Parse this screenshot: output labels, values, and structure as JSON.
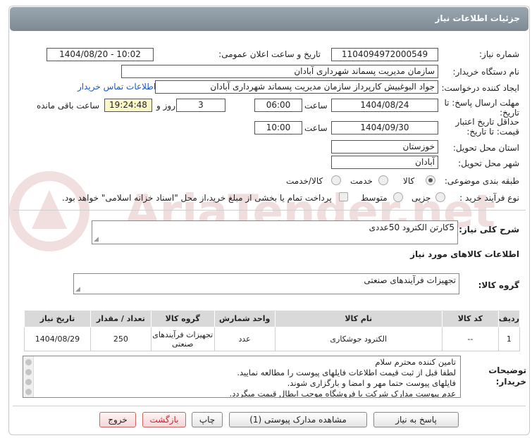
{
  "header": {
    "title": "جزئیات اطلاعات نیاز"
  },
  "fields": {
    "need_number_label": "شماره نیاز:",
    "need_number": "1104094972000549",
    "announce_label": "تاریخ و ساعت اعلان عمومی:",
    "announce_value": "1404/08/20 - 10:02",
    "buyer_org_label": "نام دستگاه خریدار:",
    "buyer_org": "سازمان مدیریت پسماند شهرداری آبادان",
    "requester_label": "ایجاد کننده درخواست:",
    "requester": "جواد البوغبیش کارپرداز سازمان مدیریت پسماند شهرداری آبادان",
    "contact_link": "اطلاعات تماس خریدار",
    "reply_deadline_label": "مهلت ارسال پاسخ: تا تاریخ:",
    "reply_date": "1404/08/24",
    "time_label": "ساعت",
    "reply_time": "06:00",
    "days_value": "3",
    "days_and": "روز و",
    "remaining_time": "19:24:48",
    "remaining_label": "ساعت باقی مانده",
    "validity_label": "حداقل تاریخ اعتبار قیمت: تا تاریخ:",
    "validity_date": "1404/09/30",
    "validity_time": "10:00",
    "province_label": "استان محل تحویل:",
    "province": "خوزستان",
    "city_label": "شهر محل تحویل:",
    "city": "آبادان",
    "category_label": "طبقه بندی موضوعی:",
    "category_options": [
      "کالا",
      "خدمت",
      "کالا/خدمت"
    ],
    "process_label": "نوع فرآیند خرید :",
    "process_options": [
      "جزیی",
      "متوسط"
    ],
    "payment_note": "پرداخت تمام یا بخشی از مبلغ خرید،از محل \"اسناد خزانه اسلامی\" خواهد بود."
  },
  "description": {
    "label": "شرح کلی نیاز:",
    "value": "5کارتن الکترود 50عددی"
  },
  "goods_section_title": "اطلاعات کالاهای مورد نیاز",
  "goods_group": {
    "label": "گروه کالا:",
    "value": "تجهیزات فرآیندهای صنعتی"
  },
  "table": {
    "headers": [
      "ردیف",
      "کد کالا",
      "نام کالا",
      "واحد شمارش",
      "گروه کالا",
      "تعداد / مقدار",
      "تاریخ نیاز"
    ],
    "rows": [
      [
        "1",
        "--",
        "الکترود جوشکاری",
        "عدد",
        "تجهیزات فرآیندهای صنعتی",
        "250",
        "1404/08/29"
      ]
    ]
  },
  "buyer_notes": {
    "label": "توضیحات خریدار:",
    "lines": [
      "تامین کننده محترم سلام",
      "لطفا قبل از ثبت قیمت اطلاعات فایلهای پیوست را مطالعه نمایید.",
      "فایلهای پیوست حتما مهر و امضا و بارگزاری شوند.",
      "عدم پیوست مدارک شرکت یا فروشگاه موجب ابطال قیمت میگردد."
    ]
  },
  "buttons": {
    "reply": "پاسخ به نیاز",
    "attachments": "مشاهده مدارک پیوستی (1)",
    "print": "چاپ",
    "back": "بازگشت",
    "exit": "خروج"
  },
  "watermark": {
    "text": "AriaTender.net"
  },
  "colors": {
    "header": "#8794a0",
    "link": "#1a56c8",
    "timer_bg": "#fbf6c5",
    "watermark": "#e9c9c9"
  }
}
